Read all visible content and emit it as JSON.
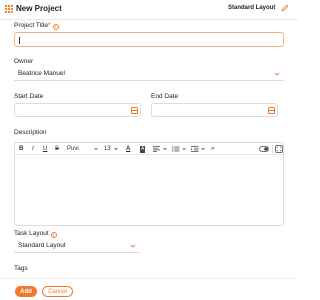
{
  "header": {
    "title": "New Project",
    "layout_button": "Standard Layout",
    "grid_icon": "app-grid-icon",
    "edit_icon": "pencil-icon"
  },
  "fields": {
    "project_title": {
      "label": "Project Title",
      "required_mark": "*",
      "value": "",
      "info_icon": "info-icon"
    },
    "owner": {
      "label": "Owner",
      "value": "Beatrice Manuel"
    },
    "start_date": {
      "label": "Start Date",
      "value": ""
    },
    "end_date": {
      "label": "End Date",
      "value": ""
    },
    "description": {
      "label": "Description",
      "toolbar": {
        "bold": "B",
        "italic": "I",
        "underline": "U",
        "strike": "S",
        "font": "Puvi",
        "size": "13",
        "font_color": "A",
        "highlight": "A",
        "more": "»"
      }
    },
    "task_layout": {
      "label": "Task Layout",
      "value": "Standard Layout",
      "info_icon": "info-icon"
    },
    "tags": {
      "label": "Tags"
    }
  },
  "actions": {
    "add": "Add",
    "cancel": "Cancel"
  },
  "colors": {
    "accent": "#f07a2a",
    "required": "#e8402e",
    "border": "#dcdcdc"
  }
}
